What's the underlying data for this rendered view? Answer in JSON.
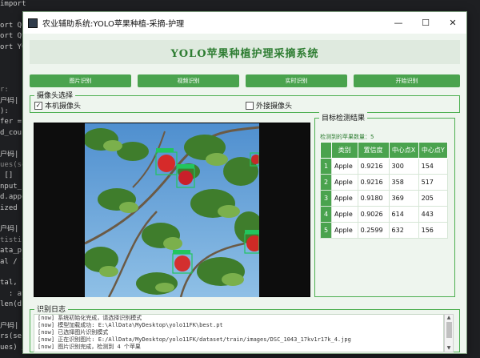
{
  "background_code": [
    "import",
    "",
    "ort QP",
    "ort QS",
    "ort YOL",
    "",
    "",
    "",
    "r:",
    "户码|",
    "):",
    "fer =",
    "d_cou",
    "",
    "户码|",
    "ues(se",
    " []",
    "nput_",
    "d.appe",
    "ized",
    "",
    "户码|",
    "tistic",
    "ata_p",
    "al / l",
    "",
    "tal,",
    "  : ave",
    "len(d",
    "",
    "户码|",
    "rs(se",
    "ues) / len(values)"
  ],
  "window": {
    "title": "农业辅助系统:YOLO苹果种植-采摘-护理",
    "controls": {
      "minimize": "—",
      "maximize": "☐",
      "close": "✕"
    }
  },
  "banner": {
    "title": "YOLO苹果种植护理采摘系统"
  },
  "buttons": {
    "image": "图片识别",
    "video": "视频识别",
    "realtime": "实时识别",
    "start": "开始识别"
  },
  "camera": {
    "group_title": "摄像头选择",
    "local_label": "本机摄像头",
    "local_checked": true,
    "external_label": "外接摄像头",
    "external_checked": false
  },
  "results": {
    "group_title": "目标检测结果",
    "count_label": "检测到的苹果数量：5",
    "columns": [
      "类别",
      "置信度",
      "中心点X",
      "中心点Y"
    ],
    "rows": [
      {
        "index": "1",
        "cls": "Apple",
        "conf": "0.9216",
        "cx": "300",
        "cy": "154"
      },
      {
        "index": "2",
        "cls": "Apple",
        "conf": "0.9216",
        "cx": "358",
        "cy": "517"
      },
      {
        "index": "3",
        "cls": "Apple",
        "conf": "0.9180",
        "cx": "369",
        "cy": "205"
      },
      {
        "index": "4",
        "cls": "Apple",
        "conf": "0.9026",
        "cx": "614",
        "cy": "443"
      },
      {
        "index": "5",
        "cls": "Apple",
        "conf": "0.2599",
        "cx": "632",
        "cy": "156"
      }
    ]
  },
  "log": {
    "group_title": "识别日志",
    "lines": [
      "[now] 系统初始化完成，请选择识别模式",
      "[now] 模型加载成功: E:\\AllData\\MyDesktop\\yolo11FK\\best.pt",
      "[now] 已选择图片识别模式",
      "[now] 正在识别图片: E:/AllData/MyDesktop/yolo11FK/dataset/train/images/DSC_1043_17kv1r17k_4.jpg",
      "[now] 图片识别完成，检测到 4 个苹果"
    ]
  },
  "colors": {
    "accent": "#4aa34e",
    "title_green": "#2e7d32",
    "window_bg": "#eef5ee"
  }
}
